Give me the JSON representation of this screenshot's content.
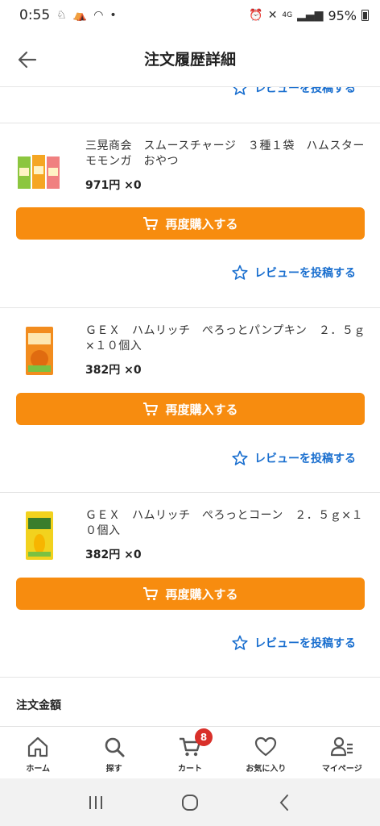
{
  "status_bar": {
    "time": "0:55",
    "network": "4G",
    "battery": "95%"
  },
  "header": {
    "title": "注文履歴詳細"
  },
  "items": [
    {
      "title": "三晃商会　スムースチャージ　３種１袋　ハムスター　モモンガ　おやつ",
      "price": "971円 ×0",
      "rebuy_label": "再度購入する",
      "review_label": "レビューを投稿する"
    },
    {
      "title": "ＧＥＸ　ハムリッチ　ぺろっとパンプキン　２．５ｇ×１０個入",
      "price": "382円 ×0",
      "rebuy_label": "再度購入する",
      "review_label": "レビューを投稿する"
    },
    {
      "title": "ＧＥＸ　ハムリッチ　ぺろっとコーン　２．５ｇ×１０個入",
      "price": "382円 ×0",
      "rebuy_label": "再度購入する",
      "review_label": "レビューを投稿する"
    }
  ],
  "top_review_label": "レビューを投稿する",
  "summary": {
    "title": "注文金額"
  },
  "bottom_nav": {
    "home": "ホーム",
    "search": "探す",
    "cart": "カート",
    "cart_badge": "8",
    "favorites": "お気に入り",
    "mypage": "マイページ"
  },
  "colors": {
    "accent": "#f78c0f",
    "link": "#1a6fcf",
    "badge": "#d9302a"
  }
}
